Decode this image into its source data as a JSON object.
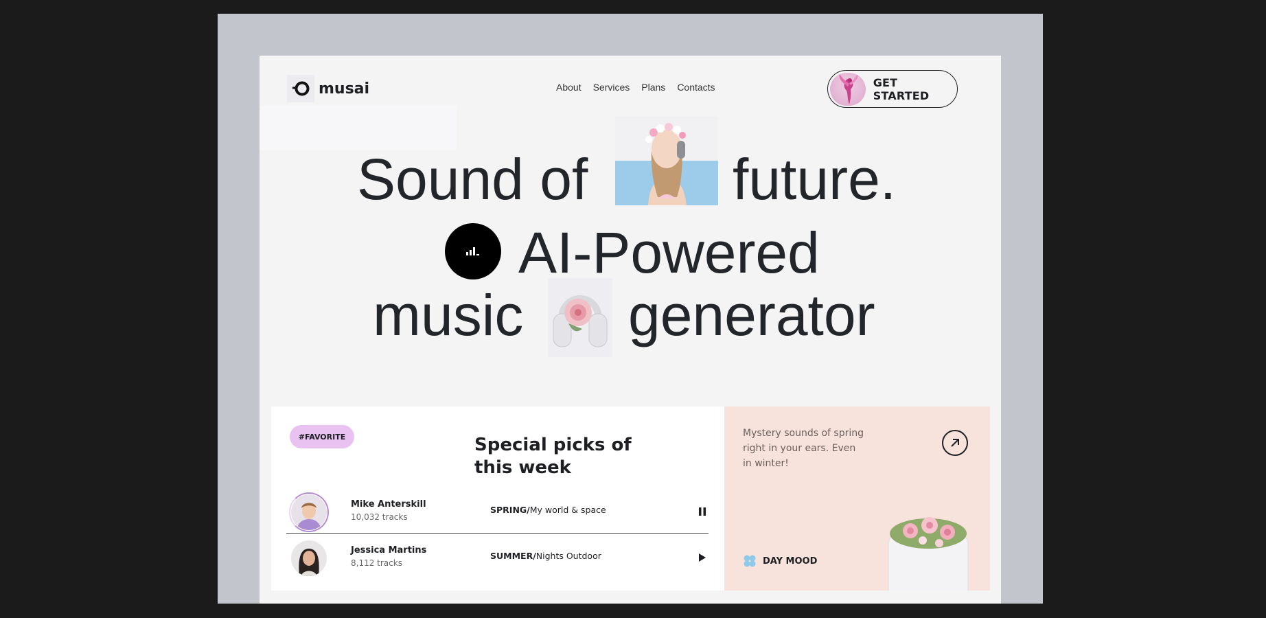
{
  "brand": {
    "name": "musai",
    "logo_icon": "ring-logo-icon"
  },
  "nav": {
    "items": [
      "About",
      "Services",
      "Plans",
      "Contacts"
    ]
  },
  "cta": {
    "label": "GET STARTED",
    "icon": "hummingbird-icon"
  },
  "hero": {
    "line1_a": "Sound of",
    "line1_b": "future.",
    "line2": "AI-Powered",
    "line3_a": "music",
    "line3_b": "generator",
    "circle_icon": "bars-icon"
  },
  "picks": {
    "tag": "#FAVORITE",
    "title": "Special picks of this week",
    "rows": [
      {
        "artist": "Mike Anterskill",
        "tracks": "10,032 tracks",
        "season": "SPRING/",
        "song": "My world & space",
        "control": "pause-icon"
      },
      {
        "artist": "Jessica Martins",
        "tracks": "8,112 tracks",
        "season": "SUMMER/",
        "song": "Nights Outdoor",
        "control": "play-icon"
      }
    ]
  },
  "promo": {
    "text": "Mystery sounds of spring right in your ears. Even in winter!",
    "arrow_icon": "arrow-up-right-icon",
    "mood_label": "DAY MOOD",
    "mood_icon": "clover-icon",
    "colors": {
      "background": "#f7e3dc",
      "tag": "#e9c2f2"
    }
  }
}
